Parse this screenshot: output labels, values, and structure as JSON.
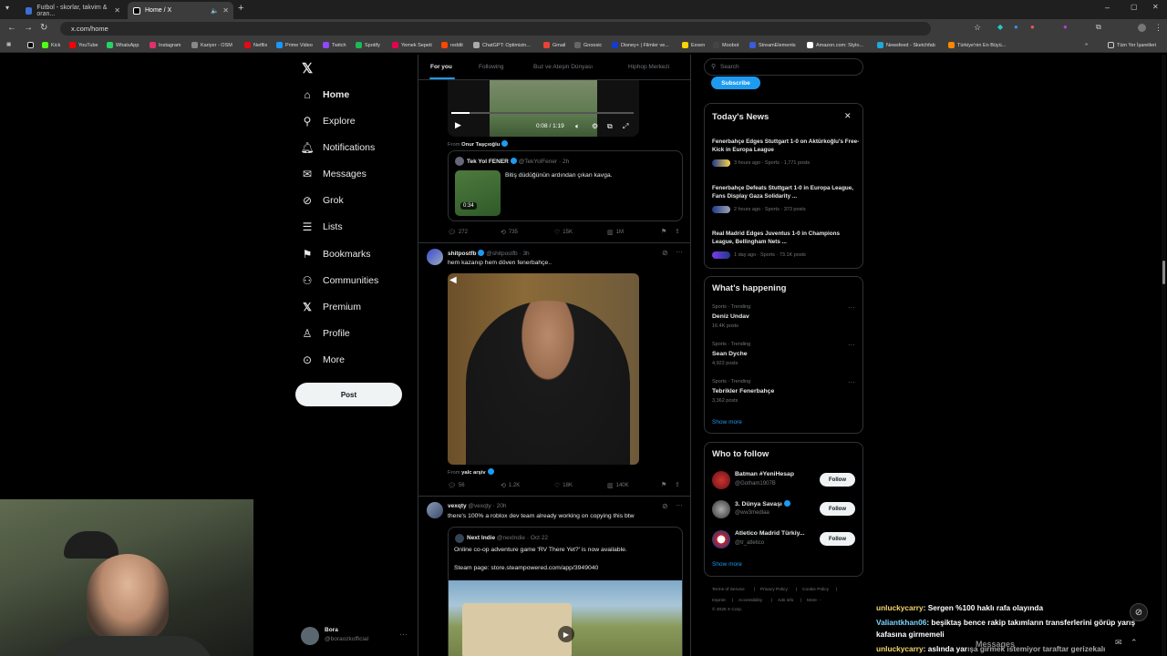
{
  "browser": {
    "tabs": [
      {
        "label": "Futbol - skorlar, takvim & oran...",
        "active": false
      },
      {
        "label": "Home / X",
        "active": true
      }
    ],
    "url": "x.com/home",
    "bookmarks": [
      "Kick",
      "YouTube",
      "WhatsApp",
      "Instagram",
      "Kariyer - OSM",
      "Netflix",
      "Prime Video",
      "Twitch",
      "Spotify",
      "Yemek Sepeti",
      "reddit",
      "ChatGPT: Optimizin...",
      "Gmail",
      "Gnoosic",
      "Disney+ | Filmler ve...",
      "Exxen",
      "Moobot",
      "StreamElements",
      "Amazon.com: Stylo...",
      "Newsfeed - Sketchfab",
      "Türkiye'nin En Büyü..."
    ],
    "all_bookmarks": "Tüm Yer İşaretleri"
  },
  "sidebar": {
    "items": [
      {
        "label": "Home",
        "icon": "home-icon"
      },
      {
        "label": "Explore",
        "icon": "search-icon"
      },
      {
        "label": "Notifications",
        "icon": "bell-icon"
      },
      {
        "label": "Messages",
        "icon": "mail-icon"
      },
      {
        "label": "Grok",
        "icon": "grok-icon"
      },
      {
        "label": "Lists",
        "icon": "list-icon"
      },
      {
        "label": "Bookmarks",
        "icon": "bookmark-icon"
      },
      {
        "label": "Communities",
        "icon": "people-icon"
      },
      {
        "label": "Premium",
        "icon": "x-logo-icon"
      },
      {
        "label": "Profile",
        "icon": "person-icon"
      },
      {
        "label": "More",
        "icon": "more-circle-icon"
      }
    ],
    "post_label": "Post",
    "account": {
      "name": "Bora",
      "handle": "@boraozkofficial"
    }
  },
  "feed": {
    "tabs": [
      "For you",
      "Following",
      "Buz ve Ateşin Dünyası",
      "Hiphop Merkezi"
    ],
    "video1": {
      "time": "0:08 / 1:19",
      "from_label": "From",
      "from_name": "Onur Taşçıoğlu"
    },
    "quote1": {
      "name": "Tek Yol FENER",
      "handle": "@TekYolFener",
      "time": "· 2h",
      "text": "Bitiş düdüğünün ardından çıkan kavga.",
      "duration": "0:34"
    },
    "actions1": {
      "replies": "272",
      "reposts": "735",
      "likes": "15K",
      "views": "1M"
    },
    "tweet2": {
      "name": "shitpostfb",
      "handle": "@shitpostfb",
      "time": "· 3h",
      "text": "hem kazanıp hem döven fenerbahçe..",
      "from_label": "From",
      "from_name": "yalc arşiv"
    },
    "actions2": {
      "replies": "56",
      "reposts": "1.2K",
      "likes": "18K",
      "views": "140K"
    },
    "tweet3": {
      "name": "vexqty",
      "handle": "@vexqty",
      "time": "· 20h",
      "text": "there's 100% a roblox dev team already working on copying this btw"
    },
    "quote3": {
      "name": "Next Indie",
      "handle": "@nexIndie",
      "time": "· Oct 22",
      "line1": "Online co-op adventure game 'RV There Yet?' is now available.",
      "line2": "Steam page: store.steampowered.com/app/3949040"
    }
  },
  "right": {
    "search_placeholder": "Search",
    "subscribe": "Subscribe",
    "news": {
      "title": "Today's News",
      "items": [
        {
          "title": "Fenerbahçe Edges Stuttgart 1-0 on Aktürkoğlu's Free-Kick in Europa League",
          "meta": "3 hours ago · Sports · 1,771 posts"
        },
        {
          "title": "Fenerbahçe Defeats Stuttgart 1-0 in Europa League, Fans Display Gaza Solidarity ...",
          "meta": "2 hours ago · Sports · 373 posts"
        },
        {
          "title": "Real Madrid Edges Juventus 1-0 in Champions League, Bellingham Nets ...",
          "meta": "1 day ago · Sports · 73.1K posts"
        }
      ]
    },
    "happening": {
      "title": "What's happening",
      "items": [
        {
          "category": "Sports · Trending",
          "name": "Deniz Undav",
          "posts": "16.4K posts"
        },
        {
          "category": "Sports · Trending",
          "name": "Sean Dyche",
          "posts": "4,922 posts"
        },
        {
          "category": "Sports · Trending",
          "name": "Tebrikler Fenerbahçe",
          "posts": "3,362 posts"
        }
      ],
      "show_more": "Show more"
    },
    "who_to_follow": {
      "title": "Who to follow",
      "items": [
        {
          "name": "Batman #YeniHesap",
          "handle": "@Gotham1907B",
          "button": "Follow"
        },
        {
          "name": "3. Dünya Savaşı",
          "handle": "@ww3medlaa",
          "button": "Follow"
        },
        {
          "name": "Atletico Madrid Türkiy...",
          "handle": "@tr_atletico",
          "button": "Follow"
        }
      ],
      "show_more": "Show more"
    },
    "footer": [
      "Terms of Service",
      "|",
      "Privacy Policy",
      "|",
      "Cookie Policy",
      "|",
      "Imprint",
      "|",
      "Accessibility",
      "|",
      "Ads info",
      "|",
      "More ···",
      "© 2025 X Corp."
    ]
  },
  "chat": {
    "messages": [
      {
        "user": "unluckycarry",
        "text": ": Sergen %100 haklı rafa olayında"
      },
      {
        "user": "Valiantkhan06",
        "text": ": beşiktaş bence rakip takımların transferlerini görüp yarış"
      },
      {
        "user": "",
        "text": "kafasına girmemeli"
      },
      {
        "user": "unluckycarry",
        "text": ": aslında yarışa girmek istemiyor taraftar gerizekalı"
      }
    ],
    "messages_drawer": "Messages"
  },
  "colors": {
    "accent": "#1d9bf0",
    "background": "#000000",
    "border": "#2f3336",
    "muted": "#71767b"
  }
}
